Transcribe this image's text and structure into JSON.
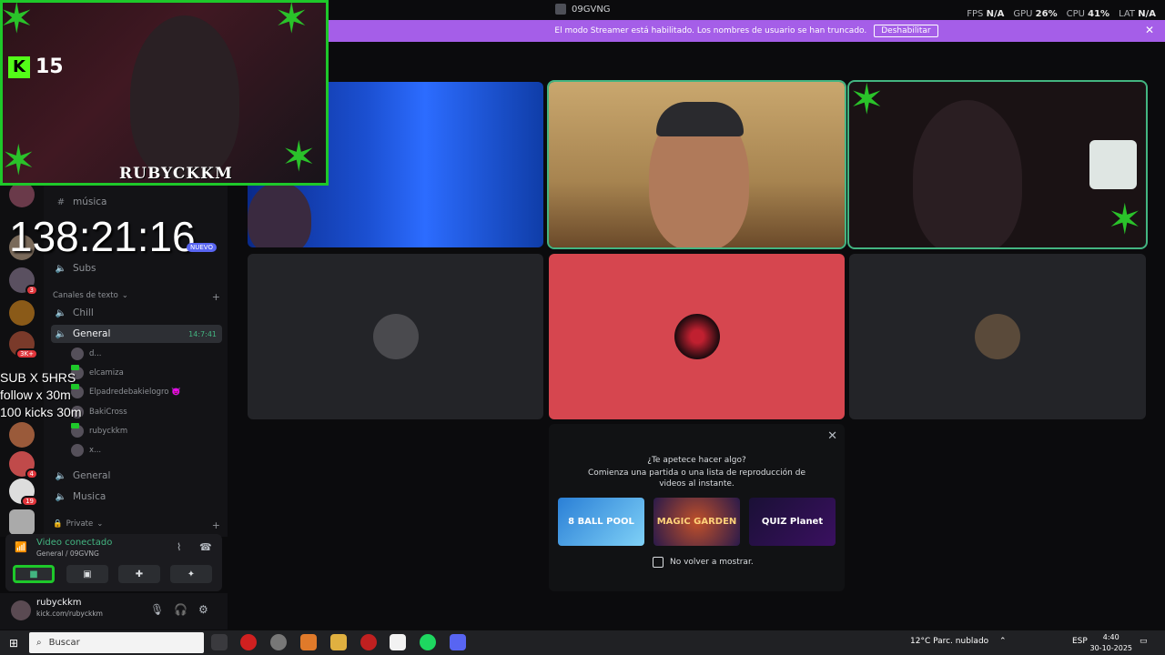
{
  "window": {
    "title": "09GVNG"
  },
  "stats": [
    {
      "label": "FPS",
      "value": "N/A"
    },
    {
      "label": "GPU",
      "value": "26%"
    },
    {
      "label": "CPU",
      "value": "41%"
    },
    {
      "label": "LAT",
      "value": "N/A"
    }
  ],
  "streamer_bar": {
    "message": "El modo Streamer está habilitado. Los nombres de usuario se han truncado.",
    "button": "Deshabilitar",
    "close": "✕"
  },
  "overlay": {
    "kick_count": "15",
    "streamer_name": "RUBYCKKM",
    "timer": "138:21:16",
    "nuevo_badge": "NUEVO",
    "subathon": [
      "SUB X 5HRS",
      "follow x 30m",
      "100 kicks 30m"
    ]
  },
  "sidebar": {
    "channels_top": [
      {
        "icon": "#",
        "label": "música"
      },
      {
        "icon": "🔈",
        "label": "Subs"
      }
    ],
    "category_text": "Canales de texto",
    "channels": [
      {
        "label": "Chill"
      },
      {
        "label": "General",
        "time": "14:7:41"
      }
    ],
    "voice_users": [
      {
        "name": "d..."
      },
      {
        "name": "elcamiza"
      },
      {
        "name": "Elpadredebakielogro 👿"
      },
      {
        "name": "BakiCross"
      },
      {
        "name": "rubyckkm"
      },
      {
        "name": "x..."
      }
    ],
    "channels_bottom": [
      {
        "label": "General"
      },
      {
        "label": "Musica"
      }
    ],
    "category_private": "Private",
    "badges": [
      "3",
      "3K+",
      "4",
      "19"
    ]
  },
  "voice_panel": {
    "status": "Video conectado",
    "channel": "General / 09GVNG"
  },
  "user_panel": {
    "name": "rubyckkm",
    "status": "kick.com/rubyckkm"
  },
  "activity": {
    "title": "¿Te apetece hacer algo?",
    "subtitle": "Comienza una partida o una lista de reproducción de videos al instante.",
    "games": [
      "8 BALL POOL",
      "MAGIC GARDEN",
      "QUIZ Planet"
    ],
    "checkbox_label": "No volver a mostrar."
  },
  "taskbar": {
    "search_placeholder": "Buscar",
    "weather": "12°C  Parc. nublado",
    "lang": "ESP",
    "time": "4:40",
    "date": "30-10-2025"
  }
}
